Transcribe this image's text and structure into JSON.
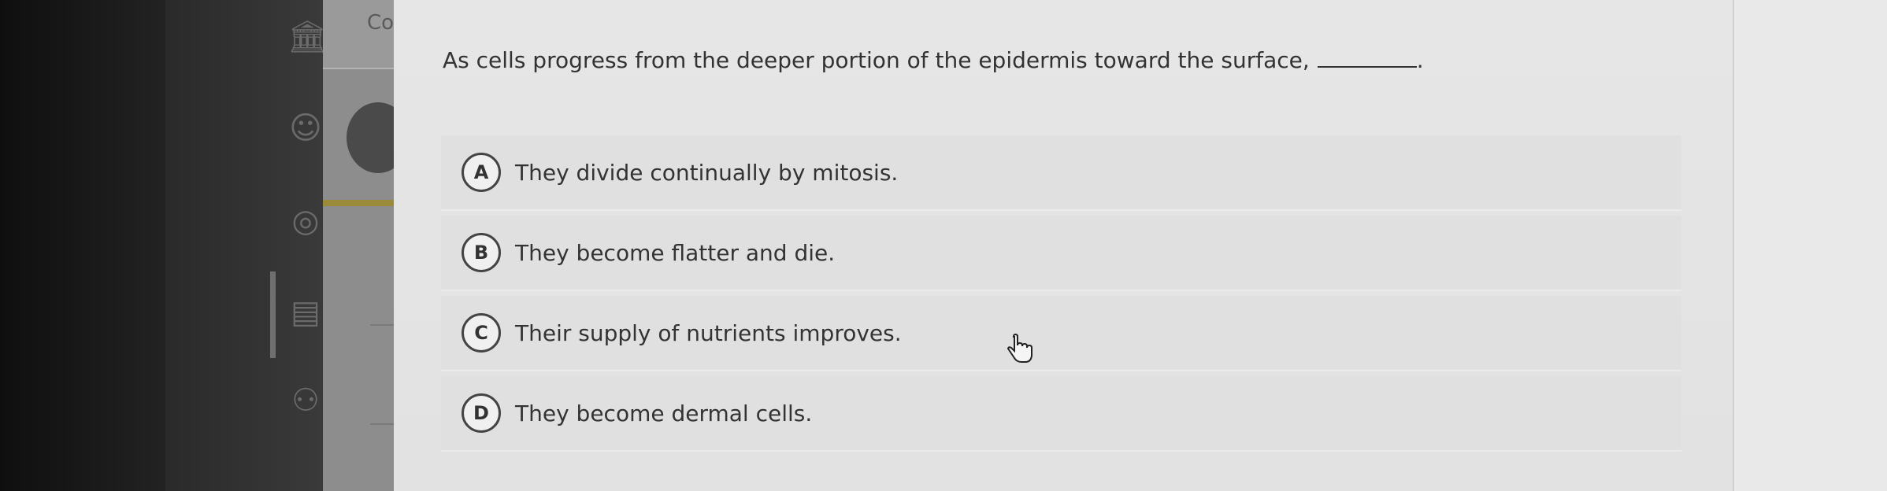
{
  "panel": {
    "heading": "Co"
  },
  "question": {
    "text": "As cells progress from the deeper portion of the epidermis toward the surface,",
    "end_punct": "."
  },
  "options": [
    {
      "letter": "A",
      "text": "They divide continually by mitosis."
    },
    {
      "letter": "B",
      "text": "They become flatter and die."
    },
    {
      "letter": "C",
      "text": "Their supply of nutrients improves."
    },
    {
      "letter": "D",
      "text": "They become dermal cells."
    }
  ],
  "sidebar": {
    "icons": [
      "bank-icon",
      "user-icon",
      "globe-icon",
      "document-icon",
      "people-icon"
    ]
  }
}
